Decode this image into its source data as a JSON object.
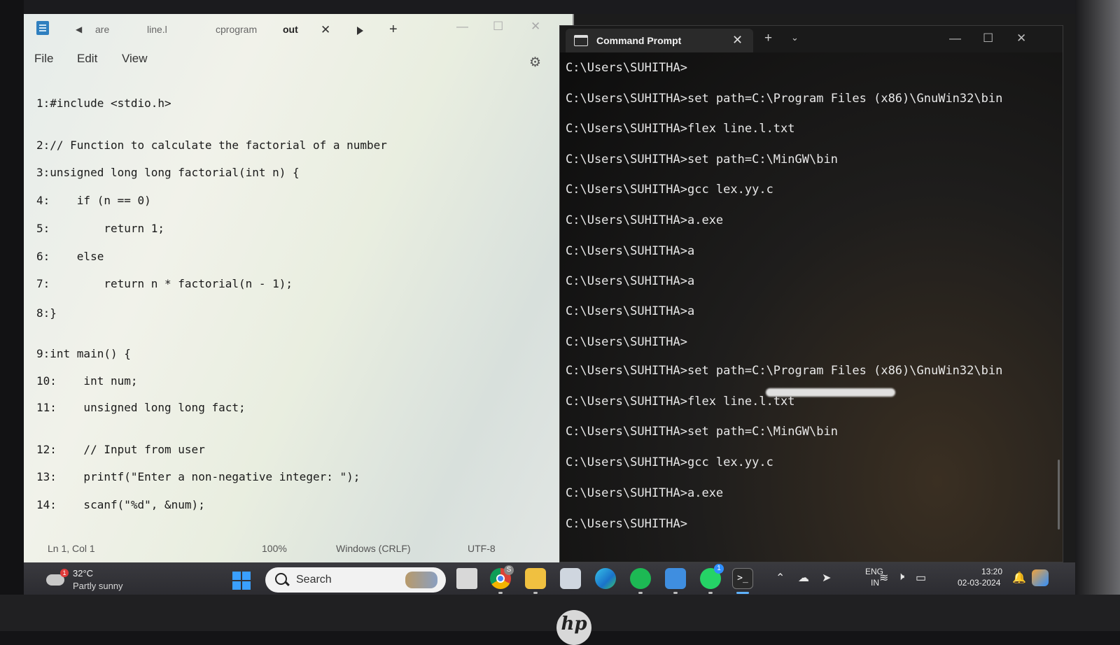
{
  "notepad": {
    "tabs": [
      "are",
      "line.l",
      "cprogram",
      "out"
    ],
    "menu": [
      "File",
      "Edit",
      "View"
    ],
    "code_lines": [
      "1:#include <stdio.h>",
      "2:// Function to calculate the factorial of a number",
      "3:unsigned long long factorial(int n) {",
      "4:    if (n == 0)",
      "5:        return 1;",
      "6:    else",
      "7:        return n * factorial(n - 1);",
      "8:}",
      "9:int main() {",
      "10:    int num;",
      "11:    unsigned long long fact;",
      "12:    // Input from user",
      "13:    printf(\"Enter a non-negative integer: \");",
      "14:    scanf(\"%d\", &num);"
    ],
    "status": {
      "position": "Ln 1, Col 1",
      "zoom": "100%",
      "line_ending": "Windows (CRLF)",
      "encoding": "UTF-8"
    }
  },
  "terminal": {
    "tab_title": "Command Prompt",
    "lines": [
      "C:\\Users\\SUHITHA>",
      "C:\\Users\\SUHITHA>set path=C:\\Program Files (x86)\\GnuWin32\\bin",
      "C:\\Users\\SUHITHA>flex line.l.txt",
      "C:\\Users\\SUHITHA>set path=C:\\MinGW\\bin",
      "C:\\Users\\SUHITHA>gcc lex.yy.c",
      "C:\\Users\\SUHITHA>a.exe",
      "C:\\Users\\SUHITHA>a",
      "C:\\Users\\SUHITHA>a",
      "C:\\Users\\SUHITHA>a",
      "C:\\Users\\SUHITHA>",
      "C:\\Users\\SUHITHA>set path=C:\\Program Files (x86)\\GnuWin32\\bin",
      "C:\\Users\\SUHITHA>flex line.l.txt",
      "C:\\Users\\SUHITHA>set path=C:\\MinGW\\bin",
      "C:\\Users\\SUHITHA>gcc lex.yy.c",
      "C:\\Users\\SUHITHA>a.exe",
      "C:\\Users\\SUHITHA>"
    ]
  },
  "taskbar": {
    "weather_temp": "32°C",
    "weather_condition": "Partly sunny",
    "weather_badge": "1",
    "search_label": "Search",
    "chrome_badge": "S",
    "whatsapp_badge": "1",
    "lang_top": "ENG",
    "lang_bottom": "IN",
    "time": "13:20",
    "date": "02-03-2024"
  },
  "logo_text": "hp"
}
